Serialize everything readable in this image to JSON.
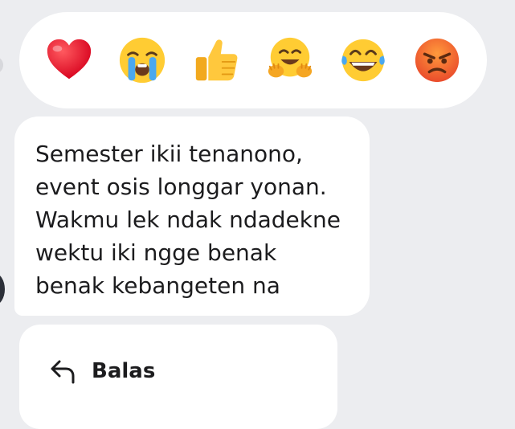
{
  "reactions": [
    {
      "name": "heart-icon",
      "label": "❤️"
    },
    {
      "name": "crying-face-icon",
      "label": "😭"
    },
    {
      "name": "thumbs-up-icon",
      "label": "👍"
    },
    {
      "name": "hugging-face-icon",
      "label": "🤗"
    },
    {
      "name": "tears-of-joy-icon",
      "label": "😂"
    },
    {
      "name": "angry-face-icon",
      "label": "😡"
    }
  ],
  "message": {
    "text": "Semester ikii tenanono,\nevent osis longgar yonan.\nWakmu lek ndak ndadekne\nwektu iki ngge benak\nbenak kebangeten na"
  },
  "menu": {
    "reply_label": "Balas",
    "reply_icon": "reply-arrow-icon"
  }
}
